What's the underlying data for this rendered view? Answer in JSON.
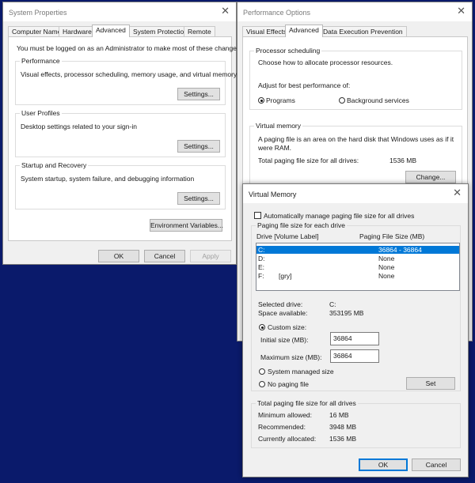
{
  "colors": {
    "desktop": "#0a1a6b",
    "accent": "#0078d7",
    "selection_text": "#ffffff"
  },
  "system_properties": {
    "title": "System Properties",
    "tabs": [
      "Computer Name",
      "Hardware",
      "Advanced",
      "System Protection",
      "Remote"
    ],
    "active_tab": "Advanced",
    "admin_note": "You must be logged on as an Administrator to make most of these changes.",
    "performance": {
      "label": "Performance",
      "desc": "Visual effects, processor scheduling, memory usage, and virtual memory",
      "button": "Settings..."
    },
    "user_profiles": {
      "label": "User Profiles",
      "desc": "Desktop settings related to your sign-in",
      "button": "Settings..."
    },
    "startup_recovery": {
      "label": "Startup and Recovery",
      "desc": "System startup, system failure, and debugging information",
      "button": "Settings..."
    },
    "env_button": "Environment Variables...",
    "ok": "OK",
    "cancel": "Cancel",
    "apply": "Apply"
  },
  "performance_options": {
    "title": "Performance Options",
    "tabs": [
      "Visual Effects",
      "Advanced",
      "Data Execution Prevention"
    ],
    "active_tab": "Advanced",
    "processor_scheduling": {
      "label": "Processor scheduling",
      "desc": "Choose how to allocate processor resources.",
      "adjust_label": "Adjust for best performance of:",
      "options": [
        "Programs",
        "Background services"
      ],
      "selected": "Programs"
    },
    "virtual_memory": {
      "label": "Virtual memory",
      "desc_line1": "A paging file is an area on the hard disk that Windows uses as if it",
      "desc_line2": "were RAM.",
      "total_label": "Total paging file size for all drives:",
      "total_value": "1536 MB",
      "change_button": "Change..."
    }
  },
  "virtual_memory": {
    "title": "Virtual Memory",
    "auto_manage_label": "Automatically manage paging file size for all drives",
    "auto_manage_checked": false,
    "group_label": "Paging file size for each drive",
    "col_drive": "Drive  [Volume Label]",
    "col_size": "Paging File Size (MB)",
    "drives": [
      {
        "drive": "C:",
        "label": "",
        "size": "36864 - 36864",
        "selected": true
      },
      {
        "drive": "D:",
        "label": "",
        "size": "None",
        "selected": false
      },
      {
        "drive": "E:",
        "label": "",
        "size": "None",
        "selected": false
      },
      {
        "drive": "F:",
        "label": "[gry]",
        "size": "None",
        "selected": false
      }
    ],
    "selected_drive_label": "Selected drive:",
    "selected_drive_value": "C:",
    "space_label": "Space available:",
    "space_value": "353195 MB",
    "custom_size_label": "Custom size:",
    "initial_label": "Initial size (MB):",
    "initial_value": "36864",
    "max_label": "Maximum size (MB):",
    "max_value": "36864",
    "system_managed_label": "System managed size",
    "no_paging_label": "No paging file",
    "size_mode": "Custom size",
    "set_button": "Set",
    "total_group_label": "Total paging file size for all drives",
    "min_label": "Minimum allowed:",
    "min_value": "16 MB",
    "rec_label": "Recommended:",
    "rec_value": "3948 MB",
    "cur_label": "Currently allocated:",
    "cur_value": "1536 MB",
    "ok": "OK",
    "cancel": "Cancel"
  }
}
